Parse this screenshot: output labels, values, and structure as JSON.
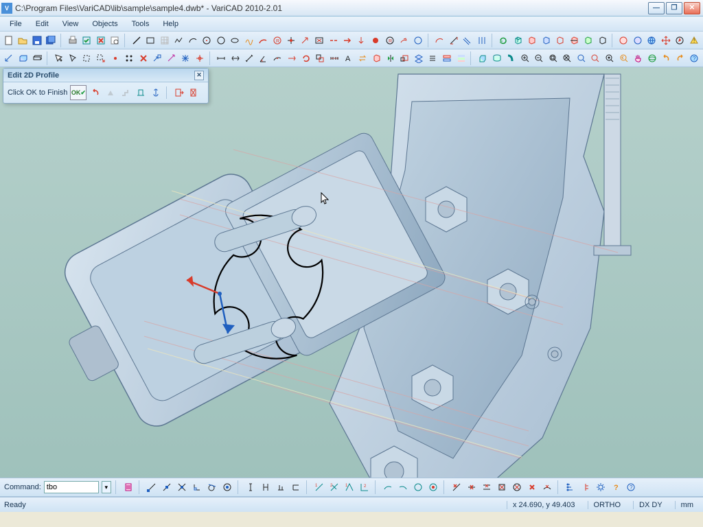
{
  "title": "C:\\Program Files\\VariCAD\\lib\\sample\\sample4.dwb* - VariCAD 2010-2.01",
  "menu": {
    "file": "File",
    "edit": "Edit",
    "view": "View",
    "objects": "Objects",
    "tools": "Tools",
    "help": "Help"
  },
  "floating": {
    "title": "Edit 2D Profile",
    "finish_text": "Click OK to Finish",
    "ok": "OK"
  },
  "command": {
    "label": "Command:",
    "value": "tbo"
  },
  "status": {
    "ready": "Ready",
    "coords": "x 24.690, y 49.403",
    "ortho": "ORTHO",
    "dxdy": "DX DY",
    "units": "mm"
  },
  "icons": {
    "c_red": "#d83b2a",
    "c_blue": "#1f5fbf",
    "c_dblue": "#164a9a",
    "c_green": "#1c9c3e",
    "c_black": "#222",
    "c_orange": "#e78b1a",
    "c_teal": "#0a8a8a",
    "c_mag": "#c02da0"
  }
}
